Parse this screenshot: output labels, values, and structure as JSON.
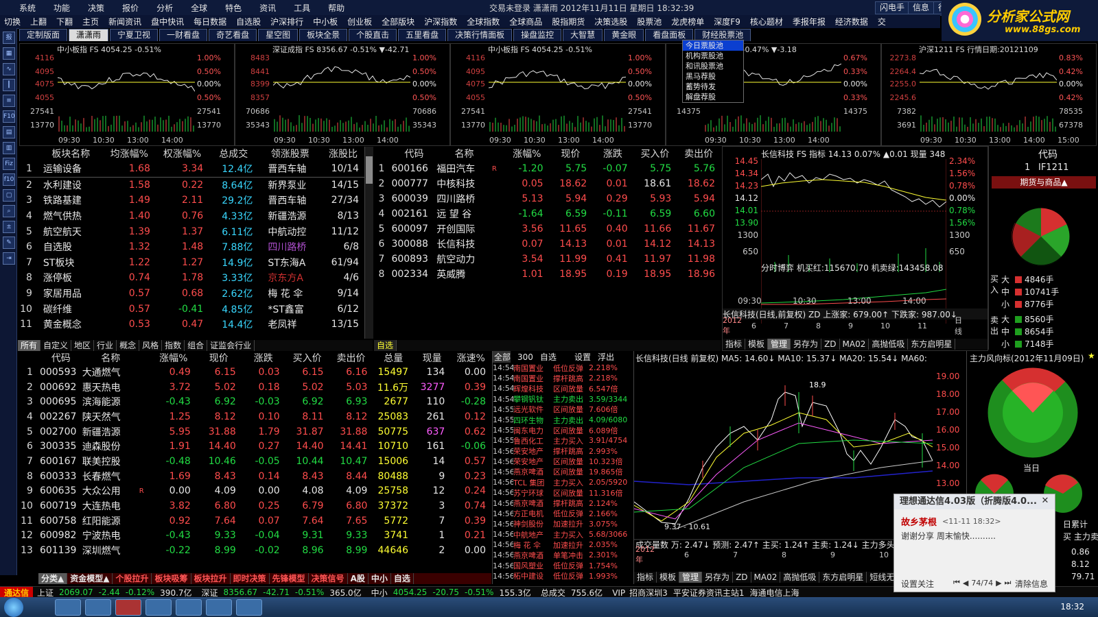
{
  "menubar": {
    "items": [
      "系统",
      "功能",
      "决策",
      "报价",
      "分析",
      "全球",
      "特色",
      "资讯",
      "工具",
      "帮助"
    ],
    "title": "交易未登录   潇潇雨 2012年11月11日 星期日 18:32:39",
    "right_buttons": [
      "闪电手",
      "信息",
      "行情"
    ]
  },
  "toolbar": {
    "items": [
      "切换",
      "上翻",
      "下翻",
      "主页",
      "新闻资讯",
      "盘中快讯",
      "每日数据",
      "自选股",
      "沪深排行",
      "中小板",
      "创业板",
      "全部版块",
      "沪深指数",
      "全球指数",
      "全球商品",
      "股指期货",
      "决策选股",
      "股票池",
      "龙虎榜单",
      "深度F9",
      "核心题材",
      "季报年报",
      "经济数据",
      "交"
    ]
  },
  "logo": {
    "line1": "分析家公式网",
    "line2": "www.88gs.com"
  },
  "tabs": [
    "定制版面",
    "潇潇雨",
    "宁夏卫视",
    "一财看盘",
    "奇艺看盘",
    "星空图",
    "板块全景",
    "个股直击",
    "五里看盘",
    "决策行情面板",
    "操盘监控",
    "大智慧",
    "黄金眼",
    "看盘面板",
    "财经股票池"
  ],
  "active_tab": 1,
  "stock_pool_menu": [
    "今日票股池",
    "机构票股池",
    "和讯股票池",
    "黑马荐股",
    "蓄势待发",
    "解盘荐股"
  ],
  "mini_charts": [
    {
      "title": "中小板指  FS 4054.25 -0.51%",
      "left": [
        "4116",
        "4095",
        "4075",
        "4055",
        "27541",
        "13770"
      ],
      "right": [
        "1.00%",
        "0.50%",
        "0.00%",
        "0.50%",
        "27541",
        "13770"
      ],
      "times": [
        "09:30",
        "10:30",
        "13:00",
        "14:00"
      ]
    },
    {
      "title": "深证成指  FS 8356.67 -0.51% ▼-42.71",
      "left": [
        "8483",
        "8441",
        "8399",
        "8357",
        "70686",
        "35343"
      ],
      "right": [
        "1.00%",
        "0.50%",
        "0.00%",
        "0.50%",
        "70686",
        "35343"
      ],
      "times": [
        "09:30",
        "10:30",
        "13:00",
        "14:00"
      ]
    },
    {
      "title": "中小板指  FS 4054.25 -0.51%",
      "left": [
        "4116",
        "4095",
        "4075",
        "4055",
        "27541",
        "13770"
      ],
      "right": [
        "1.00%",
        "0.50%",
        "0.00%",
        "0.50%",
        "27541",
        "13770"
      ],
      "times": [
        "09:30",
        "10:30",
        "13:00",
        "14:00"
      ]
    },
    {
      "title": "指  672.67 -0.47% ▼-3.18",
      "left": [
        "",
        "",
        "",
        "",
        "14375",
        ""
      ],
      "right": [
        "0.67%",
        "0.33%",
        "0.00%",
        "0.33%",
        "14375",
        ""
      ],
      "times": [
        "09:30",
        "10:30",
        "13:00",
        "14:00"
      ]
    },
    {
      "title": "沪深1211  FS 行情日期:20121109",
      "left": [
        "2273.8",
        "2264.4",
        "2255.0",
        "2245.6",
        "7382",
        "3691"
      ],
      "right": [
        "0.83%",
        "0.42%",
        "0.00%",
        "0.42%",
        "78535",
        "67378"
      ],
      "times": [
        "09:30",
        "10:30",
        "13:00",
        "14:00",
        "15:00"
      ]
    }
  ],
  "sector_table": {
    "headers": [
      "",
      "板块名称",
      "均涨幅%",
      "权涨幅%",
      "总成交",
      "领涨股票",
      "涨股比"
    ],
    "rows": [
      [
        "1",
        "运输设备",
        "1.68",
        "3.34",
        "12.4亿",
        "晋西车轴",
        "10/14"
      ],
      [
        "2",
        "水利建设",
        "1.58",
        "0.22",
        "8.64亿",
        "新界泵业",
        "14/15"
      ],
      [
        "3",
        "铁路基建",
        "1.49",
        "2.11",
        "29.2亿",
        "晋西车轴",
        "27/34"
      ],
      [
        "4",
        "燃气供热",
        "1.40",
        "0.76",
        "4.33亿",
        "新疆浩源",
        "8/13"
      ],
      [
        "5",
        "航空航天",
        "1.39",
        "1.37",
        "6.11亿",
        "中航动控",
        "11/12"
      ],
      [
        "6",
        "自选股",
        "1.32",
        "1.48",
        "7.88亿",
        "四川路桥",
        "6/8"
      ],
      [
        "7",
        "ST板块",
        "1.22",
        "1.27",
        "14.9亿",
        "ST东海A",
        "61/94"
      ],
      [
        "8",
        "涨停板",
        "0.74",
        "1.78",
        "3.33亿",
        "京东方A",
        "4/6"
      ],
      [
        "9",
        "家居用品",
        "0.57",
        "0.68",
        "2.62亿",
        "梅 花 伞",
        "9/14"
      ],
      [
        "10",
        "碳纤维",
        "0.57",
        "-0.41",
        "4.85亿",
        "*ST鑫富",
        "6/12"
      ],
      [
        "11",
        "黄金概念",
        "0.53",
        "0.47",
        "14.4亿",
        "老凤祥",
        "13/15"
      ]
    ],
    "tabs": [
      "所有",
      "自定义",
      "地区",
      "行业",
      "概念",
      "风格",
      "指数",
      "组合",
      "证监会行业"
    ]
  },
  "watch_table": {
    "headers": [
      "",
      "代码",
      "名称",
      "",
      "涨幅%",
      "现价",
      "涨跌",
      "买入价",
      "卖出价"
    ],
    "rows": [
      [
        "1",
        "600166",
        "福田汽车",
        "R",
        "-1.20",
        "5.75",
        "-0.07",
        "5.75",
        "5.76"
      ],
      [
        "2",
        "000777",
        "中核科技",
        "",
        "0.05",
        "18.62",
        "0.01",
        "18.61",
        "18.62"
      ],
      [
        "3",
        "600039",
        "四川路桥",
        "",
        "5.13",
        "5.94",
        "0.29",
        "5.93",
        "5.94"
      ],
      [
        "4",
        "002161",
        "远 望 谷",
        "",
        "-1.64",
        "6.59",
        "-0.11",
        "6.59",
        "6.60"
      ],
      [
        "5",
        "600097",
        "开创国际",
        "",
        "3.56",
        "11.65",
        "0.40",
        "11.66",
        "11.67"
      ],
      [
        "6",
        "300088",
        "长信科技",
        "",
        "0.07",
        "14.13",
        "0.01",
        "14.12",
        "14.13"
      ],
      [
        "7",
        "600893",
        "航空动力",
        "",
        "3.54",
        "11.99",
        "0.41",
        "11.97",
        "11.98"
      ],
      [
        "8",
        "002334",
        "英威腾",
        "",
        "1.01",
        "18.95",
        "0.19",
        "18.95",
        "18.96"
      ]
    ],
    "tab": "自选"
  },
  "intraday_panel": {
    "title": "长信科技  FS 指标 14.13 0.07% ▲0.01 现量 348",
    "left_axis": [
      "14.45",
      "14.34",
      "14.23",
      "14.12",
      "14.01",
      "13.90",
      "1300",
      "650"
    ],
    "right_axis": [
      "2.34%",
      "1.56%",
      "0.78%",
      "0.00%",
      "0.78%",
      "1.56%",
      "1300",
      "650"
    ],
    "sub_title": "分时博弈  机买红:115670.70  机卖绿:143458.08",
    "times": [
      "09:30",
      "10:30",
      "13:00",
      "14:00"
    ],
    "footer": "长信科技(日线,前复权) ZD  上涨家: 679.00↑  下跌家: 987.00↓",
    "footer_dates": [
      "2012年",
      "6",
      "7",
      "8",
      "9",
      "10",
      "11",
      "日线"
    ],
    "tabs": [
      "指标",
      "模板",
      "管理",
      "另存为",
      "ZD",
      "MA02",
      "高抛低吸",
      "东方启明星"
    ]
  },
  "futures_panel": {
    "code_header": "代码",
    "code_row": [
      "1",
      "IF1211"
    ],
    "title": "期货与商品▲",
    "buy_label": "买入",
    "sell_label": "卖出",
    "buy": [
      [
        "大",
        "4846手"
      ],
      [
        "中",
        "10741手"
      ],
      [
        "小",
        "8776手"
      ]
    ],
    "sell": [
      [
        "大",
        "8560手"
      ],
      [
        "中",
        "8654手"
      ],
      [
        "小",
        "7148手"
      ]
    ]
  },
  "gas_table": {
    "headers": [
      "",
      "代码",
      "名称",
      "",
      "涨幅%",
      "现价",
      "涨跌",
      "买入价",
      "卖出价",
      "总量",
      "现量",
      "涨速%"
    ],
    "rows": [
      [
        "1",
        "000593",
        "大通燃气",
        "",
        "0.49",
        "6.15",
        "0.03",
        "6.15",
        "6.16",
        "15497",
        "134",
        "0.00"
      ],
      [
        "2",
        "000692",
        "惠天热电",
        "",
        "3.72",
        "5.02",
        "0.18",
        "5.02",
        "5.03",
        "11.6万",
        "3277",
        "0.39"
      ],
      [
        "3",
        "000695",
        "滨海能源",
        "",
        "-0.43",
        "6.92",
        "-0.03",
        "6.92",
        "6.93",
        "2677",
        "110",
        "-0.28"
      ],
      [
        "4",
        "002267",
        "陕天然气",
        "",
        "1.25",
        "8.12",
        "0.10",
        "8.11",
        "8.12",
        "25083",
        "261",
        "0.12"
      ],
      [
        "5",
        "002700",
        "新疆浩源",
        "",
        "5.95",
        "31.88",
        "1.79",
        "31.87",
        "31.88",
        "50775",
        "637",
        "0.62"
      ],
      [
        "6",
        "300335",
        "迪森股份",
        "",
        "1.91",
        "14.40",
        "0.27",
        "14.40",
        "14.41",
        "10710",
        "161",
        "-0.06"
      ],
      [
        "7",
        "600167",
        "联美控股",
        "",
        "-0.48",
        "10.46",
        "-0.05",
        "10.44",
        "10.47",
        "15006",
        "14",
        "0.57"
      ],
      [
        "8",
        "600333",
        "长春燃气",
        "",
        "1.69",
        "8.43",
        "0.14",
        "8.43",
        "8.44",
        "80488",
        "9",
        "0.23"
      ],
      [
        "9",
        "600635",
        "大众公用",
        "R",
        "0.00",
        "4.09",
        "0.00",
        "4.08",
        "4.09",
        "25758",
        "12",
        "0.24"
      ],
      [
        "10",
        "600719",
        "大连热电",
        "",
        "3.82",
        "6.80",
        "0.25",
        "6.79",
        "6.80",
        "37372",
        "3",
        "0.74"
      ],
      [
        "11",
        "600758",
        "红阳能源",
        "",
        "0.92",
        "7.64",
        "0.07",
        "7.64",
        "7.65",
        "5772",
        "7",
        "0.39"
      ],
      [
        "12",
        "600982",
        "宁波热电",
        "",
        "-0.43",
        "9.33",
        "-0.04",
        "9.31",
        "9.33",
        "3741",
        "1",
        "0.21"
      ],
      [
        "13",
        "601139",
        "深圳燃气",
        "",
        "-0.22",
        "8.99",
        "-0.02",
        "8.96",
        "8.99",
        "44646",
        "2",
        "0.00"
      ]
    ],
    "bottom_tabs": [
      "分类▲",
      "资金模型▲",
      "个股拉升",
      "板块吸筹",
      "板块拉升",
      "即时决策",
      "先锋模型",
      "决策信号",
      "A股",
      "中小",
      "自选"
    ]
  },
  "alerts": {
    "tabs": [
      "全部",
      "300",
      "自选",
      "设置",
      "浮出"
    ],
    "rows": [
      [
        "14:54",
        "南国置业",
        "低位反弹",
        "2.218%"
      ],
      [
        "14:54",
        "南国置业",
        "撑杆跳高",
        "2.218%"
      ],
      [
        "14:54",
        "辉煌科技",
        "区间放量",
        "6.547倍"
      ],
      [
        "14:54",
        "攀钢钒钛",
        "主力卖出",
        "3.59/3344"
      ],
      [
        "14:55",
        "远光软件",
        "区间放量",
        "7.606倍"
      ],
      [
        "14:55",
        "四环生物",
        "主力卖出",
        "4.09/6080"
      ],
      [
        "14:55",
        "闽东电力",
        "区间放量",
        "6.089倍"
      ],
      [
        "14:55",
        "鲁西化工",
        "主力买入",
        "3.91/4754"
      ],
      [
        "14:56",
        "荣安地产",
        "撑杆跳高",
        "2.993%"
      ],
      [
        "14:56",
        "荣安地产",
        "区间放量",
        "10.323倍"
      ],
      [
        "14:56",
        "燕京啤酒",
        "区间放量",
        "19.865倍"
      ],
      [
        "14:56",
        "TCL 集团",
        "主力买入",
        "2.05/5920"
      ],
      [
        "14:56",
        "苏宁环球",
        "区间放量",
        "11.316倍"
      ],
      [
        "14:56",
        "燕京啤酒",
        "撑杆跳高",
        "2.124%"
      ],
      [
        "14:56",
        "方正电机",
        "低位反弹",
        "2.166%"
      ],
      [
        "14:56",
        "神剑股份",
        "加速拉升",
        "3.075%"
      ],
      [
        "14:56",
        "中航地产",
        "主力买入",
        "5.68/3066"
      ],
      [
        "14:56",
        "梅 花 伞",
        "加速拉升",
        "2.035%"
      ],
      [
        "14:56",
        "燕京啤酒",
        "单笔冲击",
        "2.301%"
      ],
      [
        "14:56",
        "国风塑业",
        "低位反弹",
        "1.754%"
      ],
      [
        "14:56",
        "柘中建设",
        "低位反弹",
        "1.993%"
      ]
    ]
  },
  "kline": {
    "title": "长信科技(日线 前复权)  MA5: 14.60↓  MA10: 15.37↓  MA20: 15.54↓  MA60:",
    "y_axis": [
      "19.00",
      "18.00",
      "17.00",
      "16.00",
      "15.00",
      "14.00",
      "13.00"
    ],
    "high_label": "18.9",
    "low_label": "9.37 - 10.61",
    "footer": "成交量数   万: 2.47↓  预测: 2.47↑   主买: 1.24↑   主卖: 1.24↓   主力多头:",
    "dates": [
      "2012年",
      "6",
      "7",
      "8",
      "9",
      "10"
    ],
    "tabs": [
      "指标",
      "模板",
      "管理",
      "另存为",
      "ZD",
      "MA02",
      "高抛低吸",
      "东方启明星",
      "短线无敌"
    ]
  },
  "main_force": {
    "title": "主力风向标(2012年11月09日)",
    "today_label": "当日",
    "cum_label": "日累计",
    "bottom_label": "买 主力卖",
    "side_values": [
      "0.86",
      "8.12",
      "79.71"
    ]
  },
  "popup": {
    "title": "理想通达信4.03版（折腾版4.0...",
    "sender": "故乡茅根",
    "time": "<11-11 18:32>",
    "message": "谢谢分享  周末愉快..........",
    "follow_label": "设置关注",
    "page": "74/74",
    "clear_label": "清除信息"
  },
  "status": {
    "brand": "通达信",
    "items": [
      "上证",
      "2069.07",
      "-2.44",
      "-0.12%",
      "390.7亿",
      "深证",
      "8356.67",
      "-42.71",
      "-0.51%",
      "365.0亿",
      "中小",
      "4054.25",
      "-20.75",
      "-0.51%",
      "155.3亿",
      "总成交",
      "755.6亿",
      "VIP_招商深圳3",
      "平安证券资讯主站1",
      "海通电信上海"
    ]
  },
  "taskbar": {
    "clock": "18:32"
  },
  "colors": {
    "up": "#ff4d4d",
    "down": "#22dd44",
    "flat": "#e8e8e8",
    "accent": "#ffcc00",
    "menu_bg": "#0e1a3a"
  }
}
